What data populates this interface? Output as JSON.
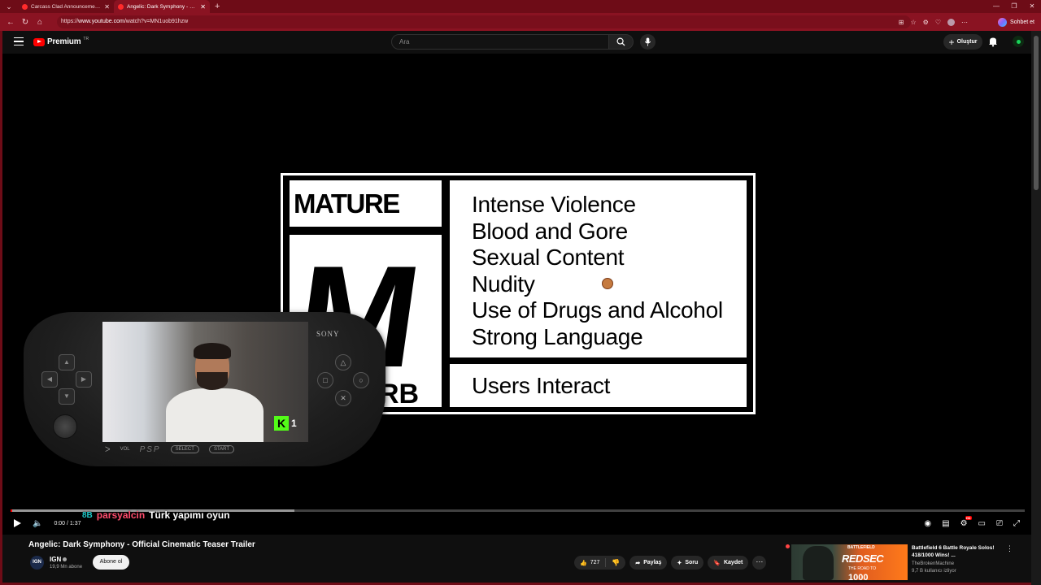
{
  "browser": {
    "tabs": [
      {
        "label": "Carcass Clad Announcement Traile",
        "active": false
      },
      {
        "label": "Angelic: Dark Symphony - Official",
        "active": true
      }
    ],
    "url_prefix": "https://",
    "url_host": "www.youtube.com",
    "url_path": "/watch?v=MN1uob91hzw",
    "chat_label": "Sohbet et",
    "theme_color": "#8a1322"
  },
  "header": {
    "logo_label": "Premium",
    "logo_sup": "TR",
    "search_placeholder": "Ara",
    "create_label": "Oluştur"
  },
  "player": {
    "rating": {
      "title": "MATURE 17+",
      "letter": "M",
      "esrb": "RB",
      "descriptors": [
        "Intense Violence",
        "Blood and Gore",
        "Sexual Content",
        "Nudity",
        "Use of Drugs and Alcohol",
        "Strong Language"
      ],
      "interactive": "Users Interact"
    },
    "overlay": {
      "brand": "SONY",
      "kick_logo": "K",
      "kick_count": "1",
      "vol_label": "VOL",
      "psp_logo": "PSP",
      "select_label": "SELECT",
      "start_label": "START"
    },
    "time": "0:00 / 1:37",
    "progress_played": 0.0,
    "progress_loaded": 0.28,
    "chat": {
      "badge": "8B",
      "user": "parsyalcin",
      "message": "Türk yapımı oyun"
    },
    "hd_badge": "HD"
  },
  "video": {
    "title": "Angelic: Dark Symphony - Official Cinematic Teaser Trailer",
    "channel": "IGN",
    "avatar_text": "IGN",
    "subscribers": "19,9 Mn abone",
    "subscribe_label": "Abone ol",
    "likes": "727",
    "share_label": "Paylaş",
    "ask_label": "Soru",
    "save_label": "Kaydet"
  },
  "recommendation": {
    "title": "Battlefield 6 Battle Royale Solos! 418/1000 Wins! ...",
    "channel": "TheBrokenMachine",
    "viewers": "9,7 B kullanıcı izliyor",
    "thumb_tag": "BATTLEFIELD",
    "thumb_title": "REDSEC",
    "thumb_sub": "THE ROAD TO",
    "thumb_num": "1000"
  }
}
